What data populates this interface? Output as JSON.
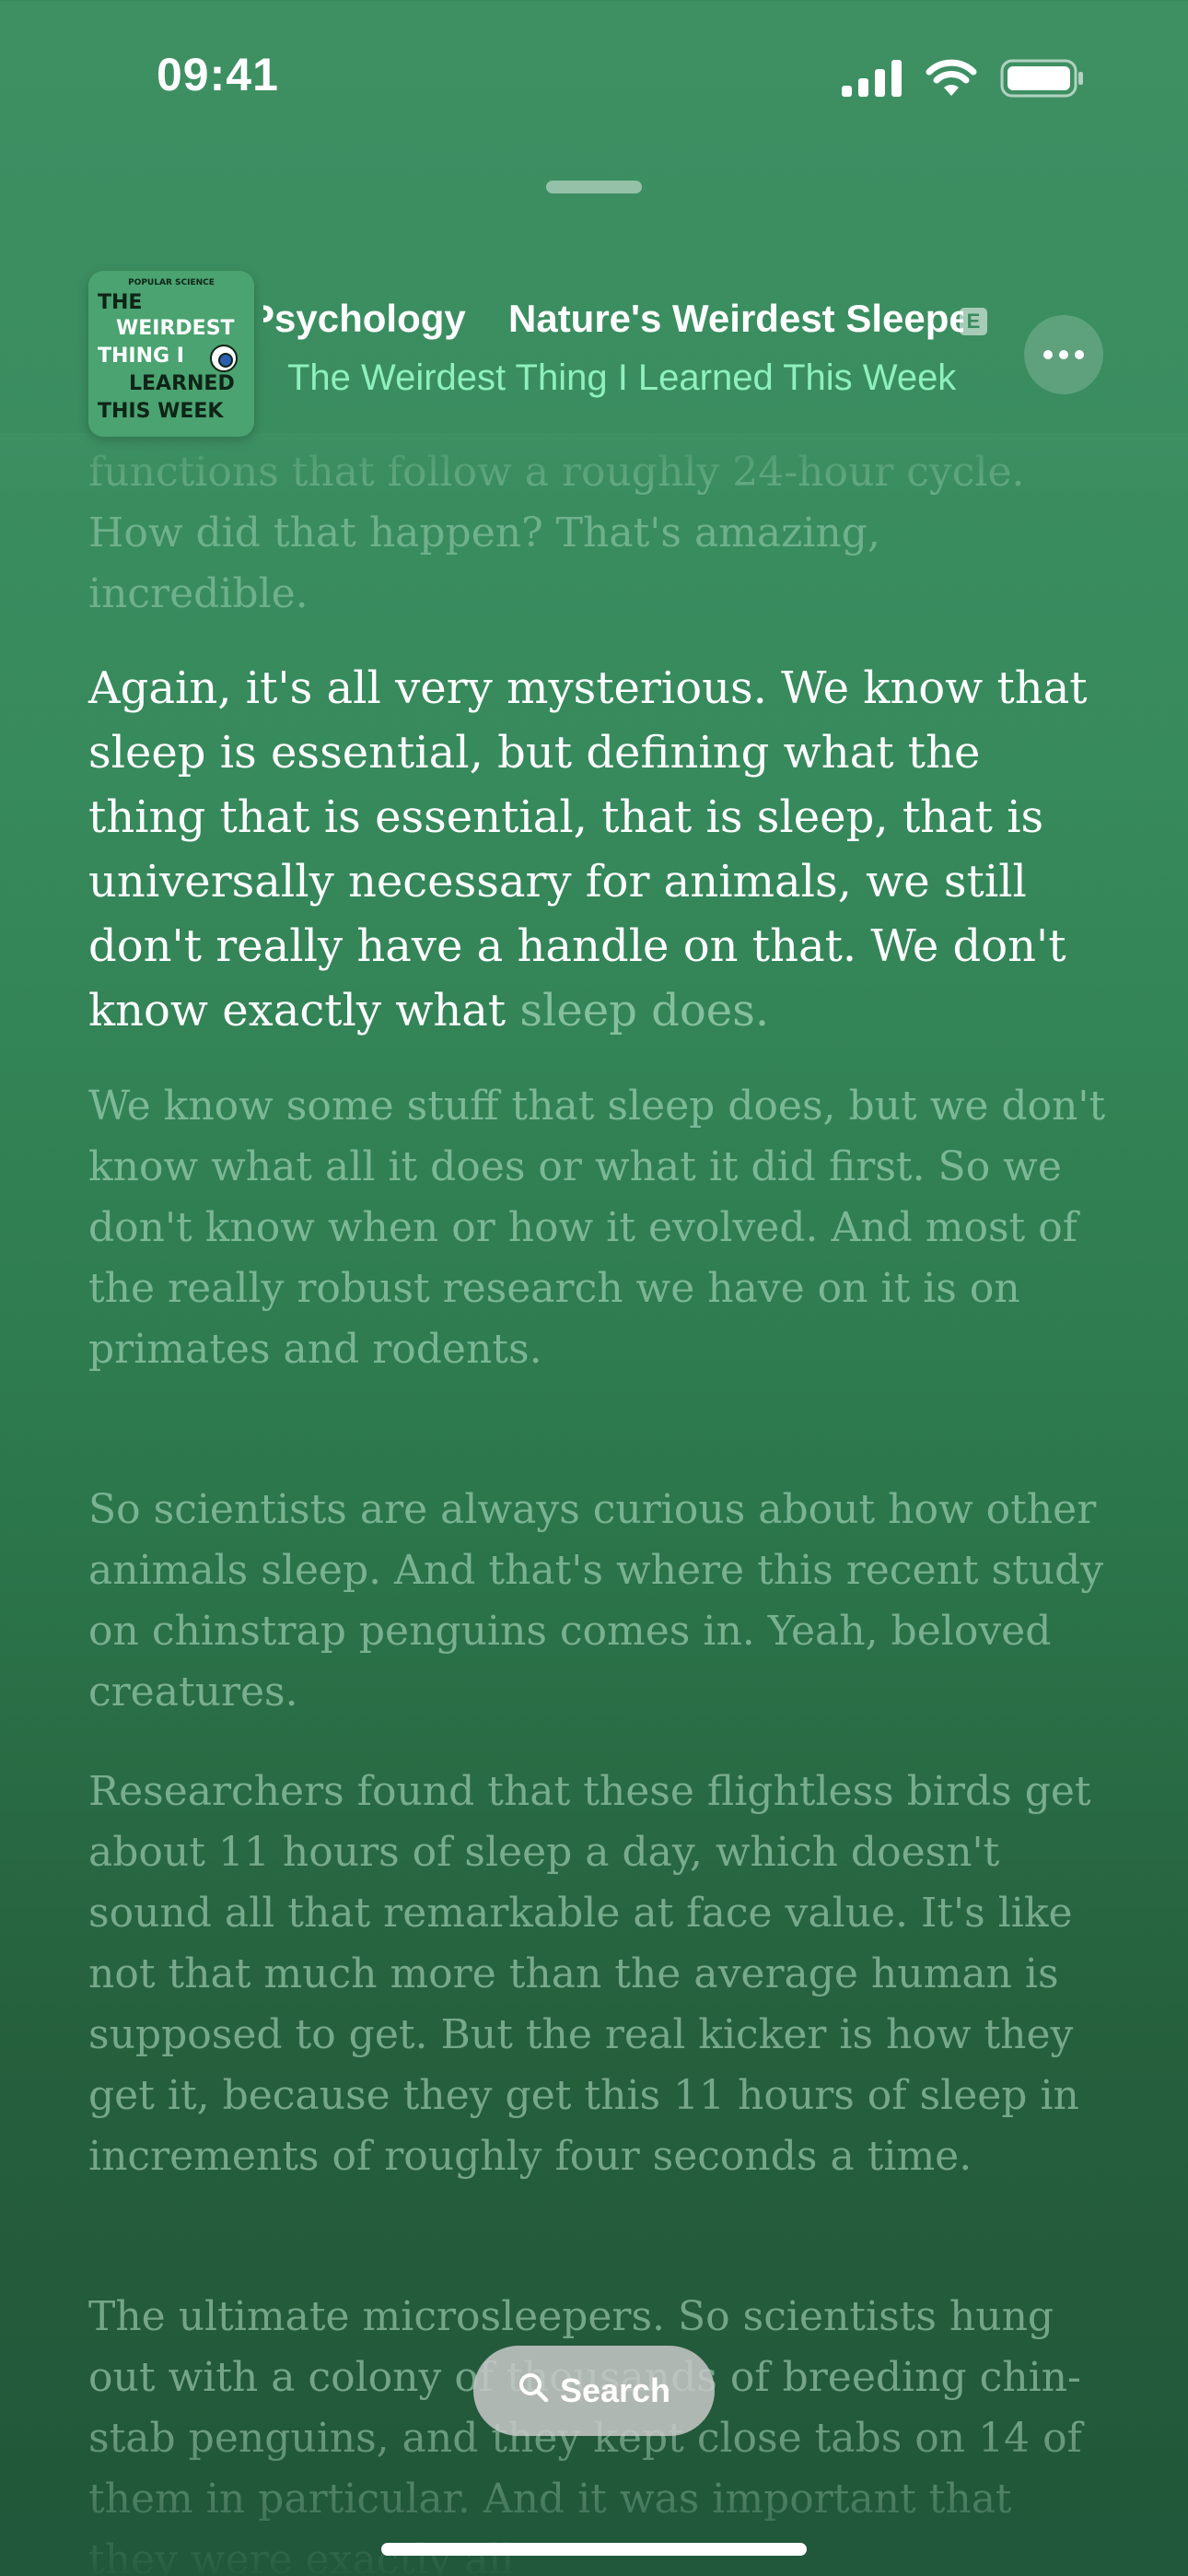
{
  "status_bar": {
    "time": "09:41",
    "icons": [
      "cellular-signal-icon",
      "wifi-icon",
      "battery-icon"
    ]
  },
  "now_playing": {
    "artwork": {
      "publisher": "POPULAR SCIENCE",
      "line1": "THE",
      "line2": "WEIRDEST",
      "line3": "THING I",
      "line4": "LEARNED",
      "line5": "THIS WEEK"
    },
    "category": "Psychology",
    "episode_title": "Nature's Weirdest Sleepers",
    "explicit_badge": "E",
    "show_name": "The Weirdest Thing I Learned This Week",
    "more_icon": "ellipsis-icon"
  },
  "transcript": {
    "previous": "functions that follow a roughly 24-hour cycle. How did that happen? That's amazing, incredible.",
    "current_spoken": "Again, it's all very mysterious. We know that sleep is essential, but defining what the thing that is essential, that is sleep, that is universally necessary for animals, we still don't really have a handle on that. We don't know exactly what",
    "current_upcoming": " sleep does.",
    "next": [
      "We know some stuff that sleep does, but we don't know what all it does or what it did first. So we don't know when or how it evolved. And most of the really robust research we have on it is on primates and rodents.",
      "So scientists are always curious about how other animals sleep. And that's where this recent study on chinstrap penguins comes in. Yeah, beloved creatures.",
      "Researchers found that these flightless birds get about 11 hours of sleep a day, which doesn't sound all that remarkable at face value. It's like not that much more than the average human is supposed to get. But the real kicker is how they get it, because they get this 11 hours of sleep in increments of roughly four seconds a time.",
      "The ultimate microsleepers. So scientists hung out with a colony of thousands of breeding chin-stab penguins, and they kept close tabs on 14 of them in particular. And it was important that they were exactly all"
    ]
  },
  "search": {
    "label": "Search",
    "icon": "search-icon"
  }
}
